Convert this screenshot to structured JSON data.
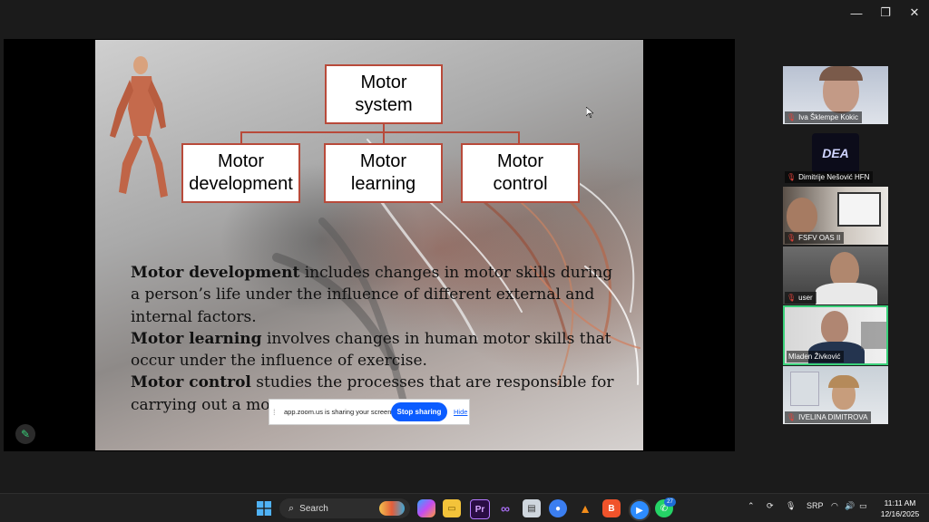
{
  "window": {
    "minimize": "—",
    "restore": "❐",
    "close": "✕"
  },
  "slide": {
    "boxes": {
      "top": "Motor\nsystem",
      "left": "Motor\ndevelopment",
      "middle": "Motor\nlearning",
      "right": "Motor\ncontrol"
    },
    "paragraphs": [
      {
        "term": "Motor development",
        "text": " includes changes in motor skills during a person’s life under the influence of different external and internal factors."
      },
      {
        "term": "Motor learning",
        "text": " involves changes in human motor skills that occur under the influence of exercise."
      },
      {
        "term": "Motor control",
        "text": " studies the processes that are responsible for carrying out a mo"
      }
    ]
  },
  "share_bar": {
    "message": "app.zoom.us is sharing your screen.",
    "stop_label": "Stop sharing",
    "hide_label": "Hide"
  },
  "participants": [
    {
      "name": "Iva Šklempe Kokic"
    },
    {
      "name": "Dimitrije Nešović HFN"
    },
    {
      "name": "FSFV OAS II"
    },
    {
      "name": "user"
    },
    {
      "name": "Mladen Živković"
    },
    {
      "name": "IVELINA DIMITROVA"
    }
  ],
  "taskbar": {
    "search_placeholder": "Search",
    "whatsapp_badge": "27",
    "language": "SRP",
    "time": "11:11 AM",
    "date": "12/16/2025"
  },
  "colors": {
    "accent": "#0b5cff",
    "active_speaker": "#3ad07a",
    "box_border": "#b84a3a"
  }
}
